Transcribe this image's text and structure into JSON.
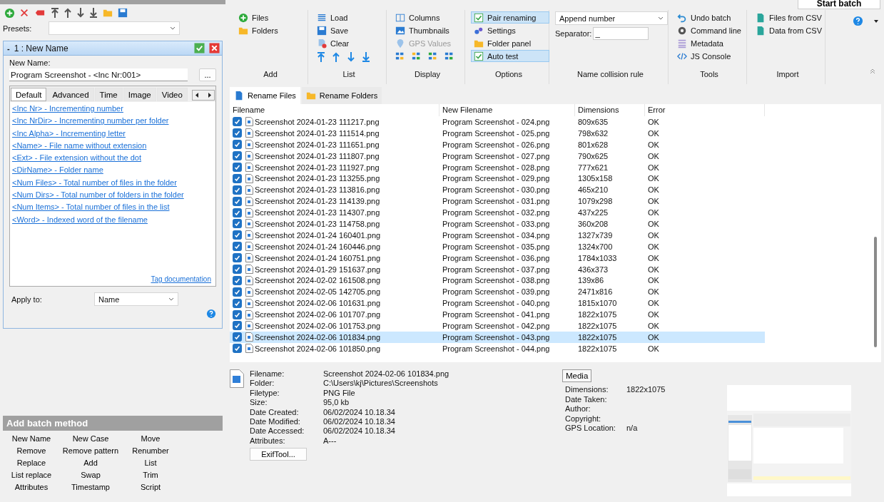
{
  "top": {
    "start_button": "Start batch"
  },
  "left": {
    "presets_label": "Presets:",
    "method": {
      "collapse": "-",
      "title": "1 : New Name",
      "enabled": true,
      "new_name_label": "New Name:",
      "new_name_value": "Program Screenshot - <Inc Nr:001>",
      "more_button": "...",
      "tabs": [
        {
          "label": "Default",
          "selected": true
        },
        {
          "label": "Advanced",
          "selected": false
        },
        {
          "label": "Time",
          "selected": false
        },
        {
          "label": "Image",
          "selected": false
        },
        {
          "label": "Video",
          "selected": false
        }
      ],
      "tags": [
        "<Inc Nr> - Incrementing number",
        "<Inc NrDir> - Incrementing number per folder",
        "<Inc Alpha> - Incrementing letter",
        "<Name> - File name without extension",
        "<Ext> - File extension without the dot",
        "<DirName> - Folder name",
        "<Num Files> - Total number of files in the folder",
        "<Num Dirs> - Total number of folders in the folder",
        "<Num Items> - Total number of files in the list",
        "<Word> - Indexed word of the filename"
      ],
      "tag_doc": "Tag documentation",
      "apply_label": "Apply to:",
      "apply_value": "Name"
    },
    "add_batch": {
      "title": "Add batch method",
      "methods": [
        "New Name",
        "New Case",
        "Move",
        "Remove",
        "Remove pattern",
        "Renumber",
        "Replace",
        "Add",
        "List",
        "List replace",
        "Swap",
        "Trim",
        "Attributes",
        "Timestamp",
        "Script"
      ]
    }
  },
  "ribbon": {
    "groups": [
      {
        "label": "Add",
        "items": [
          {
            "label": "Files",
            "kind": "button",
            "disabled": false
          },
          {
            "label": "Folders",
            "kind": "button",
            "disabled": false
          }
        ]
      },
      {
        "label": "List",
        "items": [
          {
            "label": "Load",
            "kind": "button",
            "disabled": false
          },
          {
            "label": "Save",
            "kind": "button",
            "disabled": false
          },
          {
            "label": "Clear",
            "kind": "button",
            "disabled": false
          }
        ]
      },
      {
        "label": "Display",
        "items": [
          {
            "label": "Columns",
            "kind": "button",
            "disabled": false
          },
          {
            "label": "Thumbnails",
            "kind": "button",
            "disabled": false
          },
          {
            "label": "GPS Values",
            "kind": "button",
            "disabled": true
          }
        ]
      },
      {
        "label": "Options",
        "items": [
          {
            "label": "Pair renaming",
            "kind": "check",
            "checked": true,
            "disabled": false
          },
          {
            "label": "Settings",
            "kind": "button",
            "disabled": false
          },
          {
            "label": "Folder panel",
            "kind": "button",
            "disabled": false
          },
          {
            "label": "Auto test",
            "kind": "check",
            "checked": true,
            "disabled": false
          }
        ]
      },
      {
        "label": "Name collision rule",
        "select": "Append number",
        "separator_label": "Separator:",
        "separator_value": "_"
      },
      {
        "label": "Tools",
        "items": [
          {
            "label": "Undo batch",
            "kind": "button",
            "disabled": false
          },
          {
            "label": "Command line",
            "kind": "button",
            "disabled": false
          },
          {
            "label": "Metadata",
            "kind": "button",
            "disabled": false
          },
          {
            "label": "JS Console",
            "kind": "button",
            "disabled": false
          }
        ]
      },
      {
        "label": "Import",
        "items": [
          {
            "label": "Files from CSV",
            "kind": "button",
            "disabled": false
          },
          {
            "label": "Data from CSV",
            "kind": "button",
            "disabled": false
          }
        ]
      }
    ]
  },
  "view_tabs": [
    {
      "label": "Rename Files",
      "selected": true
    },
    {
      "label": "Rename Folders",
      "selected": false
    }
  ],
  "table": {
    "columns": [
      "Filename",
      "New Filename",
      "Dimensions",
      "Error"
    ],
    "rows": [
      {
        "checked": true,
        "selected": false,
        "filename": "Screenshot 2024-01-23 111217.png",
        "new_filename": "Program Screenshot - 024.png",
        "dimensions": "809x635",
        "error": "OK"
      },
      {
        "checked": true,
        "selected": false,
        "filename": "Screenshot 2024-01-23 111514.png",
        "new_filename": "Program Screenshot - 025.png",
        "dimensions": "798x632",
        "error": "OK"
      },
      {
        "checked": true,
        "selected": false,
        "filename": "Screenshot 2024-01-23 111651.png",
        "new_filename": "Program Screenshot - 026.png",
        "dimensions": "801x628",
        "error": "OK"
      },
      {
        "checked": true,
        "selected": false,
        "filename": "Screenshot 2024-01-23 111807.png",
        "new_filename": "Program Screenshot - 027.png",
        "dimensions": "790x625",
        "error": "OK"
      },
      {
        "checked": true,
        "selected": false,
        "filename": "Screenshot 2024-01-23 111927.png",
        "new_filename": "Program Screenshot - 028.png",
        "dimensions": "777x621",
        "error": "OK"
      },
      {
        "checked": true,
        "selected": false,
        "filename": "Screenshot 2024-01-23 113255.png",
        "new_filename": "Program Screenshot - 029.png",
        "dimensions": "1305x158",
        "error": "OK"
      },
      {
        "checked": true,
        "selected": false,
        "filename": "Screenshot 2024-01-23 113816.png",
        "new_filename": "Program Screenshot - 030.png",
        "dimensions": "465x210",
        "error": "OK"
      },
      {
        "checked": true,
        "selected": false,
        "filename": "Screenshot 2024-01-23 114139.png",
        "new_filename": "Program Screenshot - 031.png",
        "dimensions": "1079x298",
        "error": "OK"
      },
      {
        "checked": true,
        "selected": false,
        "filename": "Screenshot 2024-01-23 114307.png",
        "new_filename": "Program Screenshot - 032.png",
        "dimensions": "437x225",
        "error": "OK"
      },
      {
        "checked": true,
        "selected": false,
        "filename": "Screenshot 2024-01-23 114758.png",
        "new_filename": "Program Screenshot - 033.png",
        "dimensions": "360x208",
        "error": "OK"
      },
      {
        "checked": true,
        "selected": false,
        "filename": "Screenshot 2024-01-24 160401.png",
        "new_filename": "Program Screenshot - 034.png",
        "dimensions": "1327x739",
        "error": "OK"
      },
      {
        "checked": true,
        "selected": false,
        "filename": "Screenshot 2024-01-24 160446.png",
        "new_filename": "Program Screenshot - 035.png",
        "dimensions": "1324x700",
        "error": "OK"
      },
      {
        "checked": true,
        "selected": false,
        "filename": "Screenshot 2024-01-24 160751.png",
        "new_filename": "Program Screenshot - 036.png",
        "dimensions": "1784x1033",
        "error": "OK"
      },
      {
        "checked": true,
        "selected": false,
        "filename": "Screenshot 2024-01-29 151637.png",
        "new_filename": "Program Screenshot - 037.png",
        "dimensions": "436x373",
        "error": "OK"
      },
      {
        "checked": true,
        "selected": false,
        "filename": "Screenshot 2024-02-02 161508.png",
        "new_filename": "Program Screenshot - 038.png",
        "dimensions": "139x86",
        "error": "OK"
      },
      {
        "checked": true,
        "selected": false,
        "filename": "Screenshot 2024-02-05 142705.png",
        "new_filename": "Program Screenshot - 039.png",
        "dimensions": "2471x816",
        "error": "OK"
      },
      {
        "checked": true,
        "selected": false,
        "filename": "Screenshot 2024-02-06 101631.png",
        "new_filename": "Program Screenshot - 040.png",
        "dimensions": "1815x1070",
        "error": "OK"
      },
      {
        "checked": true,
        "selected": false,
        "filename": "Screenshot 2024-02-06 101707.png",
        "new_filename": "Program Screenshot - 041.png",
        "dimensions": "1822x1075",
        "error": "OK"
      },
      {
        "checked": true,
        "selected": false,
        "filename": "Screenshot 2024-02-06 101753.png",
        "new_filename": "Program Screenshot - 042.png",
        "dimensions": "1822x1075",
        "error": "OK"
      },
      {
        "checked": true,
        "selected": true,
        "filename": "Screenshot 2024-02-06 101834.png",
        "new_filename": "Program Screenshot - 043.png",
        "dimensions": "1822x1075",
        "error": "OK"
      },
      {
        "checked": true,
        "selected": false,
        "filename": "Screenshot 2024-02-06 101850.png",
        "new_filename": "Program Screenshot - 044.png",
        "dimensions": "1822x1075",
        "error": "OK"
      }
    ]
  },
  "details": {
    "fields": [
      {
        "label": "Filename:",
        "value": "Screenshot 2024-02-06 101834.png"
      },
      {
        "label": "Folder:",
        "value": "C:\\Users\\kj\\Pictures\\Screenshots"
      },
      {
        "label": "Filetype:",
        "value": "PNG File"
      },
      {
        "label": "Size:",
        "value": "95,0 kb"
      },
      {
        "label": "Date Created:",
        "value": "06/02/2024 10.18.34"
      },
      {
        "label": "Date Modified:",
        "value": "06/02/2024 10.18.34"
      },
      {
        "label": "Date Accessed:",
        "value": "06/02/2024 10.18.34"
      },
      {
        "label": "Attributes:",
        "value": "A---"
      }
    ],
    "exif_button": "ExifTool...",
    "media_tab": {
      "label": "Media",
      "selected": true
    },
    "media_fields": [
      {
        "label": "Dimensions:",
        "value": "1822x1075"
      },
      {
        "label": "Date Taken:"
      },
      {
        "label": "Author:"
      },
      {
        "label": "Copyright:"
      },
      {
        "label": "GPS Location:",
        "value": "n/a"
      }
    ]
  }
}
